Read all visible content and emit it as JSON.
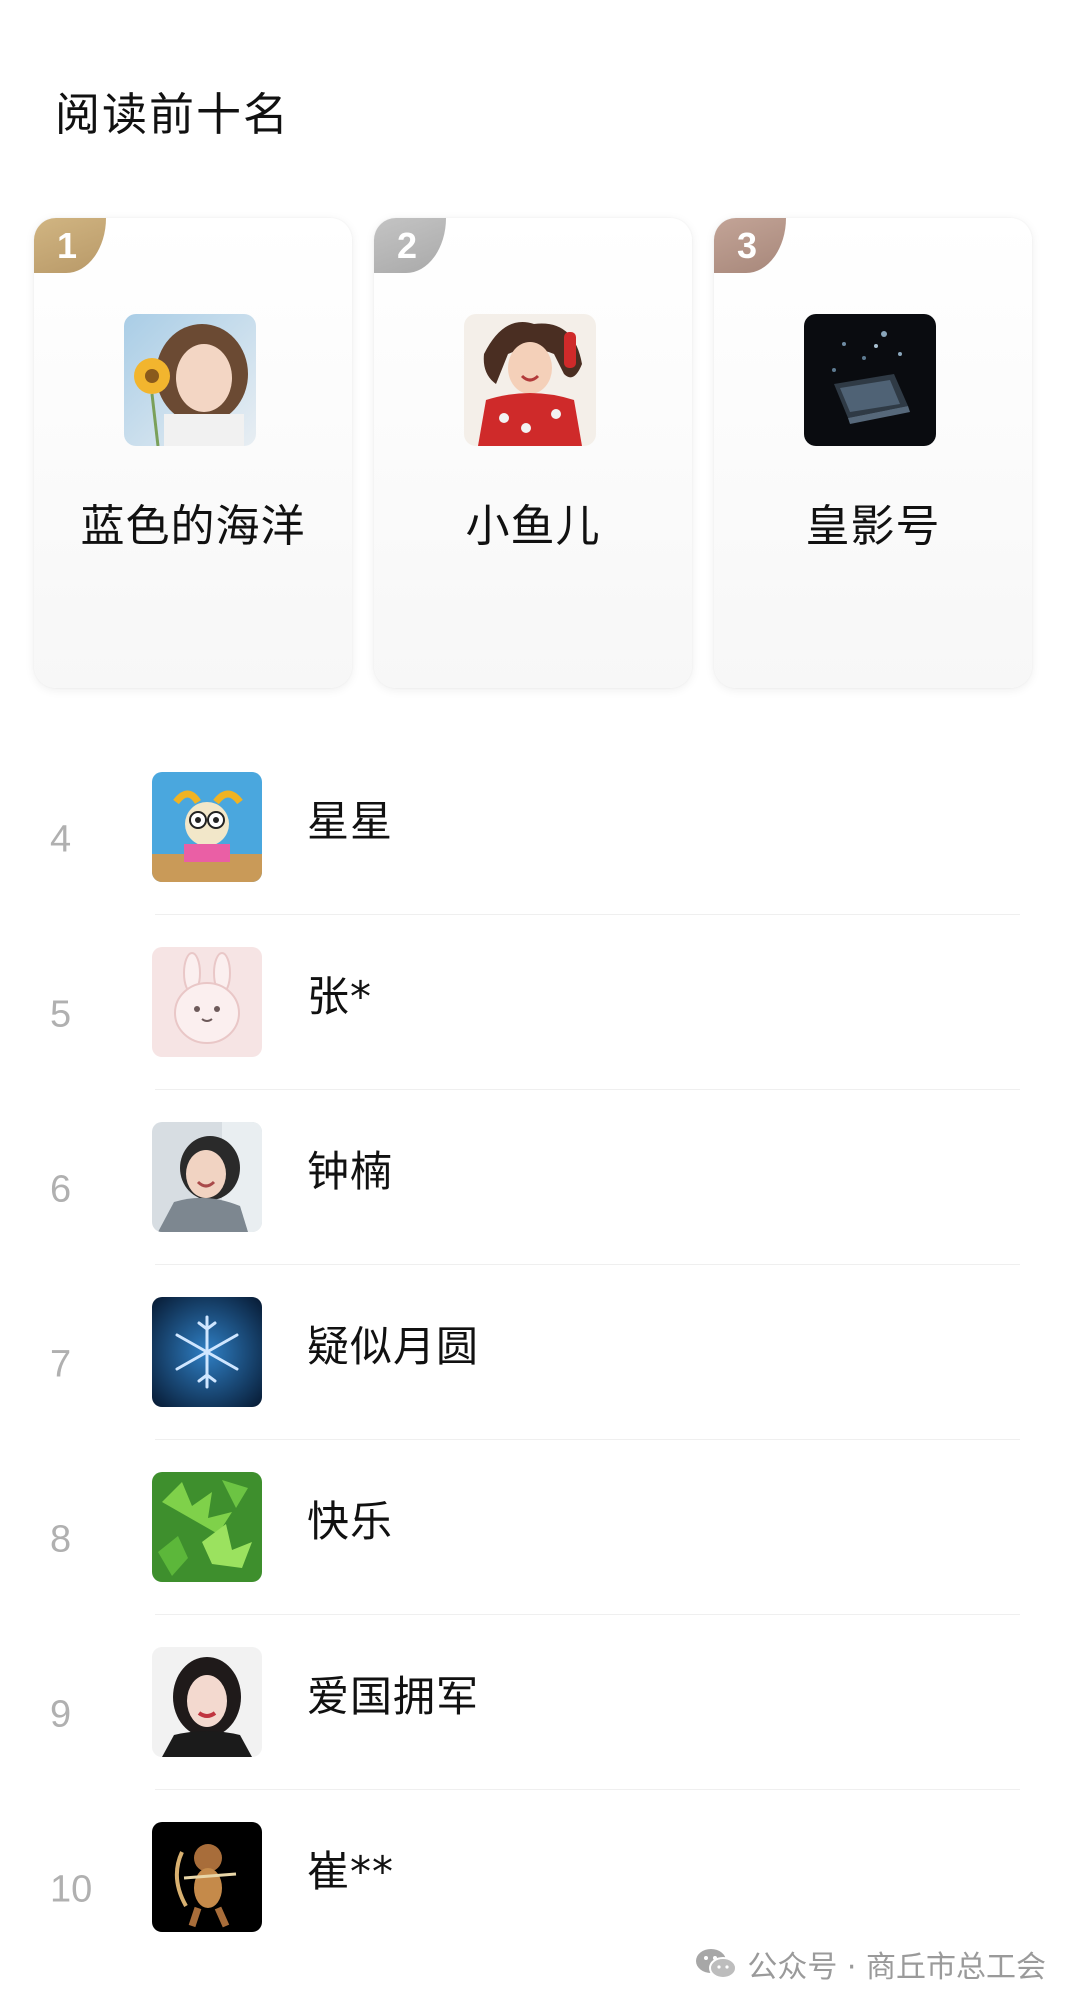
{
  "title": "阅读前十名",
  "top3": [
    {
      "rank": "1",
      "name": "蓝色的海洋",
      "badge_color": "#c9ad7a"
    },
    {
      "rank": "2",
      "name": "小鱼儿",
      "badge_color": "#b5b5b5"
    },
    {
      "rank": "3",
      "name": "皇影号",
      "badge_color": "#b3958a"
    }
  ],
  "list": [
    {
      "rank": "4",
      "name": "星星"
    },
    {
      "rank": "5",
      "name": "张*"
    },
    {
      "rank": "6",
      "name": "钟楠"
    },
    {
      "rank": "7",
      "name": "疑似月圆"
    },
    {
      "rank": "8",
      "name": "快乐"
    },
    {
      "rank": "9",
      "name": "爱国拥军"
    },
    {
      "rank": "10",
      "name": "崔**"
    }
  ],
  "watermark": {
    "text": "公众号 · 商丘市总工会",
    "icon": "wechat-icon"
  }
}
